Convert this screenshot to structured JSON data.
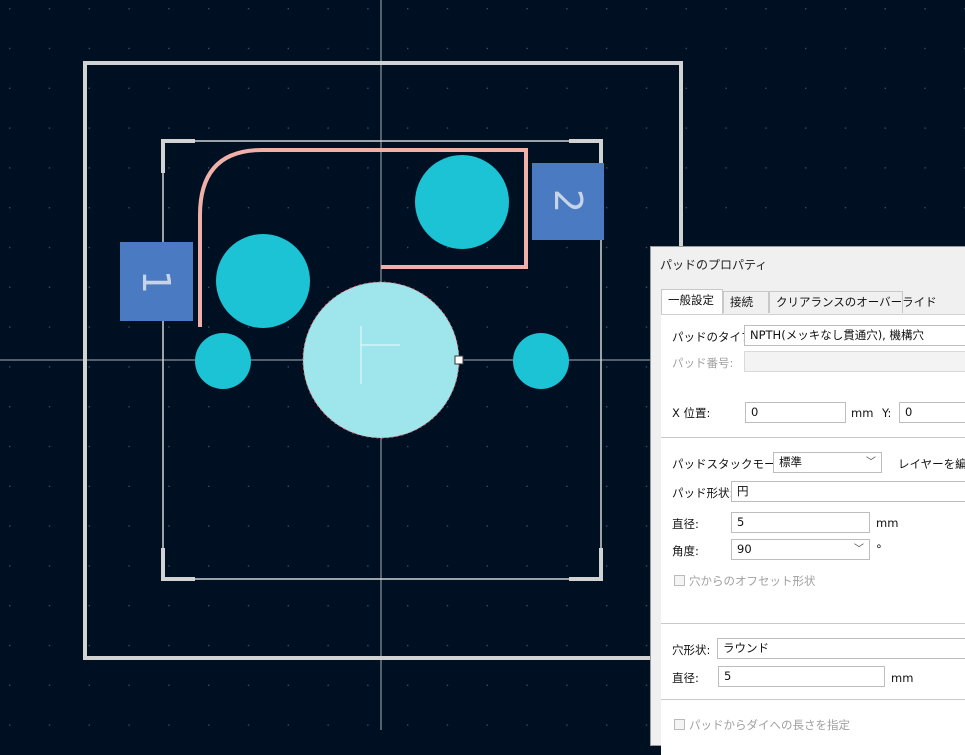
{
  "colors": {
    "background": "#001023",
    "grid_dot": "#3b4a5e",
    "outline": "#c9c9c9",
    "courtyard": "#d2d2d2",
    "silkscreen": "#f0b0a8",
    "pad": "#1cc3d4",
    "selected_pad": "#9fe6ec",
    "pad_label_bg": "#4a7bc2",
    "pad_label_text": "#c7d3e6"
  },
  "canvas": {
    "pad_numbers": [
      "1",
      "2"
    ]
  },
  "dialog": {
    "title": "パッドのプロパティ",
    "tabs": [
      "一般設定",
      "接続",
      "クリアランスのオーバーライド"
    ],
    "pad_type_label": "パッドのタイプ:",
    "pad_type_value": "NPTH(メッキなし貫通穴), 機構穴",
    "pad_number_label": "パッド番号:",
    "x_label": "X 位置:",
    "x_value": "0",
    "x_unit": "mm",
    "y_label": "Y:",
    "y_value": "0",
    "stack_mode_label": "パッドスタックモード:",
    "stack_mode_value": "標準",
    "edit_layers_label": "レイヤーを編集",
    "pad_shape_label": "パッド形状:",
    "pad_shape_value": "円",
    "diameter_label": "直径:",
    "diameter_value": "5",
    "diameter_unit": "mm",
    "angle_label": "角度:",
    "angle_value": "90",
    "angle_unit": "°",
    "offset_checkbox_label": "穴からのオフセット形状",
    "hole_shape_label": "穴形状:",
    "hole_shape_value": "ラウンド",
    "hole_diameter_label": "直径:",
    "hole_diameter_value": "5",
    "hole_diameter_unit": "mm",
    "die_length_checkbox_label": "パッドからダイへの長さを指定"
  }
}
